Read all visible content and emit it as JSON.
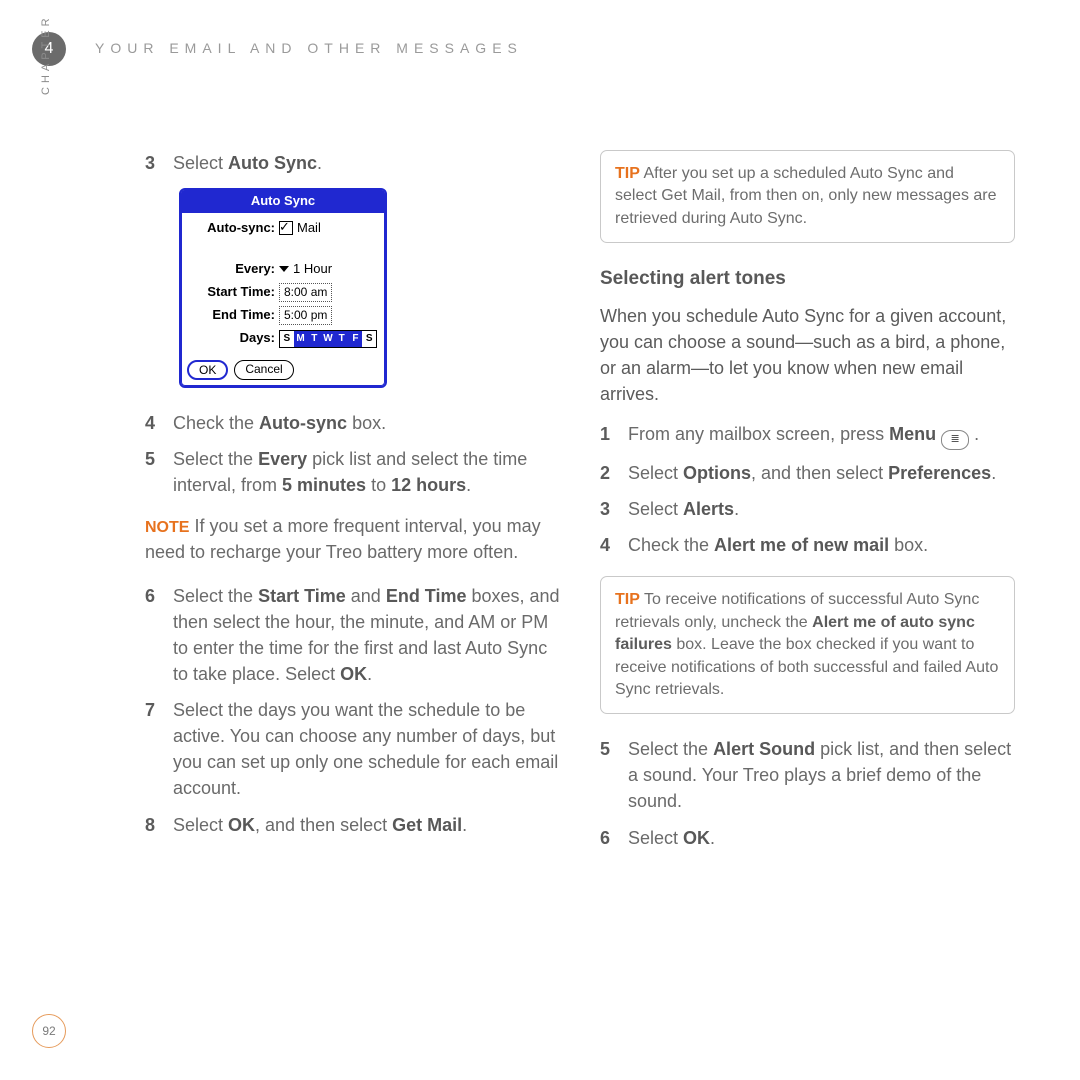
{
  "chapter": {
    "number": "4",
    "label": "CHAPTER"
  },
  "runningTitle": "YOUR EMAIL AND OTHER MESSAGES",
  "pageNumber": "92",
  "left": {
    "step3": {
      "n": "3",
      "prefix": "Select ",
      "bold": "Auto Sync",
      "suffix": "."
    },
    "step4": {
      "n": "4",
      "prefix": "Check the ",
      "bold": "Auto-sync",
      "suffix": " box."
    },
    "step5": {
      "n": "5",
      "p1": "Select the ",
      "b1": "Every",
      "p2": " pick list and select the time interval, from ",
      "b2": "5 minutes",
      "p3": " to ",
      "b3": "12 hours",
      "p4": "."
    },
    "note": {
      "label": "NOTE",
      "text": " If you set a more frequent interval, you may need to recharge your Treo battery more often."
    },
    "step6": {
      "n": "6",
      "p1": "Select the ",
      "b1": "Start Time",
      "p2": " and ",
      "b2": "End Time",
      "p3": " boxes, and then select the hour, the minute, and AM or PM to enter the time for the first and last Auto Sync to take place. Select ",
      "b3": "OK",
      "p4": "."
    },
    "step7": {
      "n": "7",
      "text": "Select the days you want the schedule to be active. You can choose any number of days, but you can set up only one schedule for each email account."
    },
    "step8": {
      "n": "8",
      "p1": "Select ",
      "b1": "OK",
      "p2": ", and then select ",
      "b2": "Get Mail",
      "p3": "."
    }
  },
  "dialog": {
    "title": "Auto Sync",
    "rows": {
      "autosync_label": "Auto-sync:",
      "autosync_value": "Mail",
      "every_label": "Every:",
      "every_value": "1 Hour",
      "start_label": "Start Time:",
      "start_value": "8:00 am",
      "end_label": "End Time:",
      "end_value": "5:00 pm",
      "days_label": "Days:"
    },
    "days": [
      "S",
      "M",
      "T",
      "W",
      "T",
      "F",
      "S"
    ],
    "days_selected": [
      false,
      true,
      true,
      true,
      true,
      true,
      false
    ],
    "buttons": {
      "ok": "OK",
      "cancel": "Cancel"
    }
  },
  "right": {
    "tip1": {
      "label": "TIP",
      "text": " After you set up a scheduled Auto Sync and select Get Mail, from then on, only new messages are retrieved during Auto Sync."
    },
    "section_title": "Selecting alert tones",
    "intro": "When you schedule Auto Sync for a given account, you can choose a sound—such as a bird, a phone, or an alarm—to let you know when new email arrives.",
    "step1": {
      "n": "1",
      "p1": "From any mailbox screen, press ",
      "b1": "Menu",
      "p2": " ."
    },
    "step2": {
      "n": "2",
      "p1": "Select ",
      "b1": "Options",
      "p2": ", and then select ",
      "b2": "Preferences",
      "p3": "."
    },
    "step3": {
      "n": "3",
      "p1": "Select ",
      "b1": "Alerts",
      "p2": "."
    },
    "step4": {
      "n": "4",
      "p1": "Check the ",
      "b1": "Alert me of new mail",
      "p2": " box."
    },
    "tip2": {
      "label": "TIP",
      "p1": " To receive notifications of successful Auto Sync retrievals only, uncheck the ",
      "b1": "Alert me of auto sync failures",
      "p2": " box. Leave the box checked if you want to receive notifications of both successful and failed Auto Sync retrievals."
    },
    "step5": {
      "n": "5",
      "p1": "Select the ",
      "b1": "Alert Sound",
      "p2": " pick list, and then select a sound. Your Treo plays a brief demo of the sound."
    },
    "step6": {
      "n": "6",
      "p1": "Select ",
      "b1": "OK",
      "p2": "."
    }
  }
}
